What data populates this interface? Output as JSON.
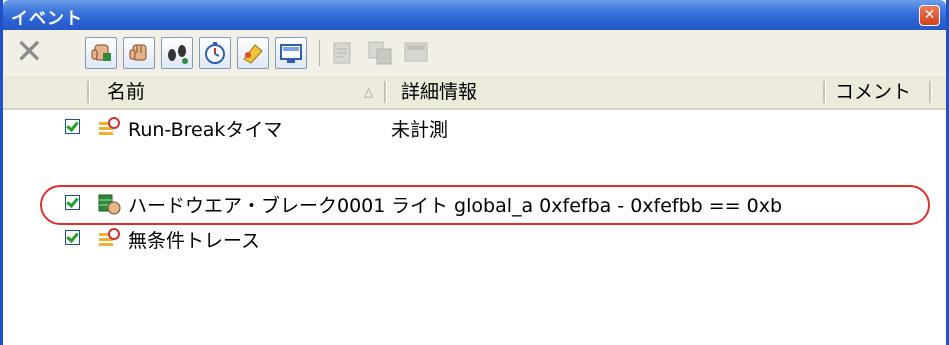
{
  "window": {
    "title": "イベント",
    "close_glyph": "✕"
  },
  "toolbar": {
    "delete_glyph": "✕",
    "buttons": [
      {
        "icon": "hand-break-icon"
      },
      {
        "icon": "hand-stop-icon"
      },
      {
        "icon": "footprints-icon"
      },
      {
        "icon": "timer-icon"
      },
      {
        "icon": "trace-icon"
      },
      {
        "icon": "monitor-icon"
      },
      {
        "icon": "edit-disabled-icon"
      },
      {
        "icon": "copy-disabled-icon"
      },
      {
        "icon": "view-disabled-icon"
      }
    ]
  },
  "columns": {
    "name": "名前",
    "sort_glyph": "△",
    "detail": "詳細情報",
    "comment": "コメント"
  },
  "rows": [
    {
      "checked": true,
      "icon": "timer-event-icon",
      "name": "Run-Breakタイマ",
      "detail": "未計測"
    },
    {
      "checked": true,
      "icon": "hardware-break-icon",
      "name": "ハードウエア・ブレーク0001",
      "detail": "ライト  global_a 0xfefba - 0xfefbb == 0xb"
    },
    {
      "checked": true,
      "icon": "trace-event-icon",
      "name": "無条件トレース",
      "detail": ""
    }
  ],
  "colors": {
    "titlebar": "#2a62d2",
    "highlight": "#e0302a",
    "check": "#21a121"
  }
}
